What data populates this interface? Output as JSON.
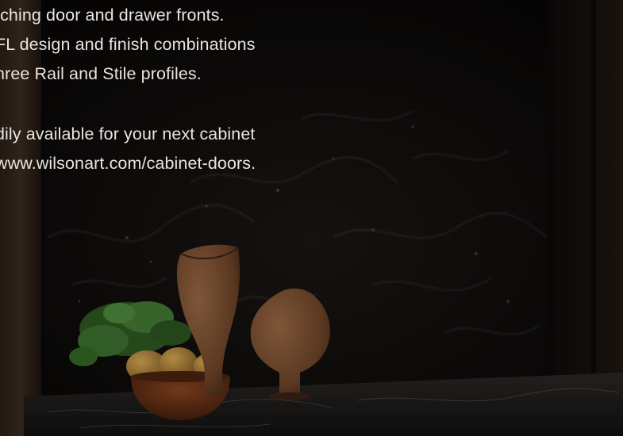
{
  "hero": {
    "paragraph_1": [
      "tching door and drawer fronts.",
      "FL design and finish combinations",
      "hree Rail and Stile profiles."
    ],
    "paragraph_2": [
      "dily available for your next cabinet",
      "www.wilsonart.com/cabinet-doors."
    ]
  },
  "colors": {
    "backsplash": "#0a0908",
    "text": "#e8e4de",
    "vase": "#7a4f33",
    "plant": "#3c6a2c",
    "pears": "#b98a3b",
    "bowl": "#6b3518"
  }
}
